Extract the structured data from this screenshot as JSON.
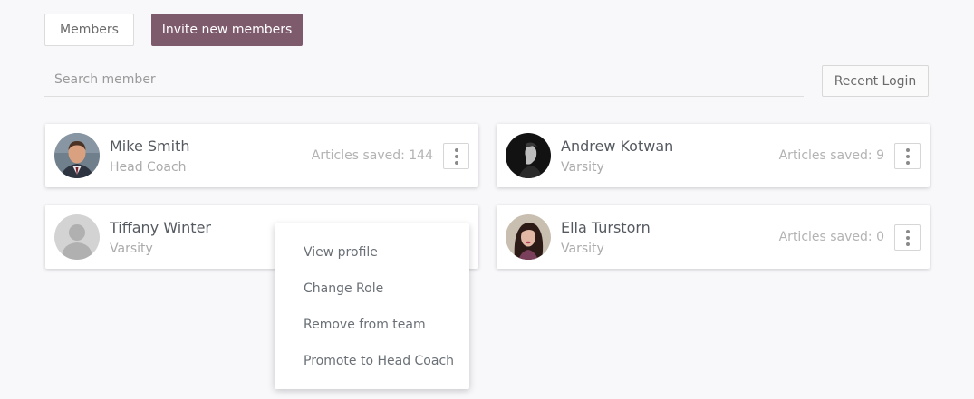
{
  "tabs": {
    "members_label": "Members",
    "invite_label": "Invite new members"
  },
  "search": {
    "placeholder": "Search member",
    "value": ""
  },
  "recent_login_label": "Recent Login",
  "colors": {
    "accent": "#7d5a6c",
    "background": "#f8f7fa"
  },
  "members": [
    {
      "name": "Mike Smith",
      "role": "Head Coach",
      "stats": "Articles saved: 144",
      "avatar": "photo-man-suit"
    },
    {
      "name": "Andrew Kotwan",
      "role": "Varsity",
      "stats": "Articles saved: 9",
      "avatar": "photo-dark-portrait"
    },
    {
      "name": "Tiffany Winter",
      "role": "Varsity",
      "stats": "",
      "avatar": "default-user-icon"
    },
    {
      "name": "Ella Turstorn",
      "role": "Varsity",
      "stats": "Articles saved: 0",
      "avatar": "photo-woman"
    }
  ],
  "menu": {
    "items": [
      {
        "label": "View profile"
      },
      {
        "label": "Change Role"
      },
      {
        "label": "Remove from team"
      },
      {
        "label": "Promote to Head Coach"
      }
    ]
  }
}
